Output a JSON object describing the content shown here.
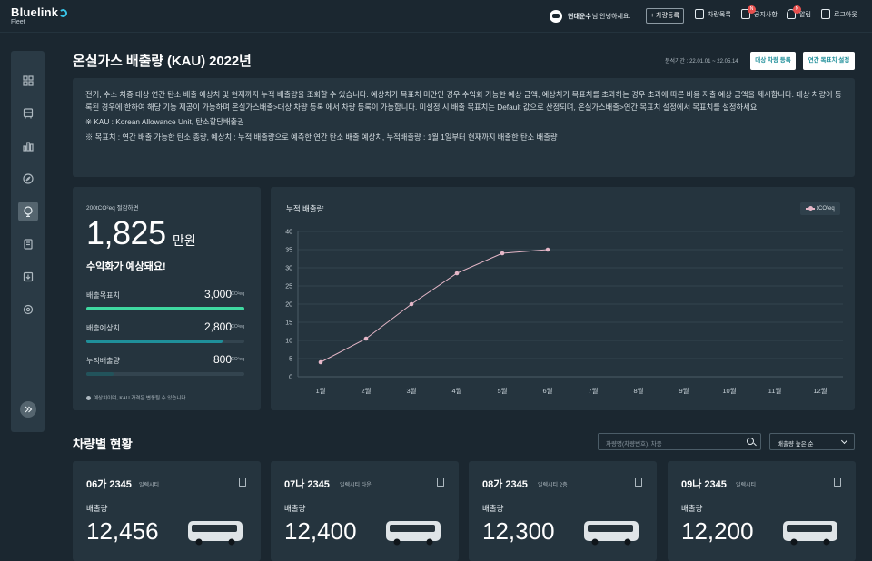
{
  "header": {
    "logo": "Bluelink",
    "logo_sub": "Fleet",
    "user_name": "현대운수",
    "user_greeting": "님 안녕하세요.",
    "register_btn": "+ 차량등록",
    "nav": [
      {
        "label": "차량목록",
        "icon": "vehicle-list-icon"
      },
      {
        "label": "공지사항",
        "icon": "notice-icon",
        "badge": "N"
      },
      {
        "label": "알림",
        "icon": "bell-icon",
        "badge": "N"
      },
      {
        "label": "로그아웃",
        "icon": "logout-icon"
      }
    ]
  },
  "sidebar": {
    "items": [
      "dashboard-icon",
      "bus-icon",
      "chart-icon",
      "compass-icon",
      "leaf-icon",
      "document-icon",
      "download-icon",
      "settings-icon"
    ],
    "active_index": 4
  },
  "page": {
    "title": "온실가스 배출량 (KAU) 2022년",
    "period": "분석기간 : 22.01.01 ~ 22.05.14",
    "btn_target_vehicle": "대상 차량 등록",
    "btn_annual_goal": "연간 목표치 설정"
  },
  "info": {
    "paragraph": "전기, 수소 차종 대상 연간 탄소 배출 예상치 및 현재까지 누적 배출량을 조회할 수 있습니다. 예상치가 목표치 미만인 경우 수익화 가능한 예상 금액, 예상치가 목표치를 초과하는 경우 초과에 따른 비용 지출 예상 금액을 제시합니다. 대상 차량이 등록된 경우에 한하여 해당 기능 제공이 가능하며 온실가스배출>대상 차량 등록 에서 차량 등록이 가능합니다. 미설정 시 배출 목표치는 Default 값으로 산정되며, 온실가스배출>연간 목표치 설정에서 목표치를 설정하세요.",
    "note1": "※ KAU : Korean Allowance Unit, 탄소할당배출권",
    "note2": "※ 목표치 : 연간 배출 가능한 탄소 총량, 예상치 : 누적 배출량으로 예측한 연간 탄소 배출 예상치, 누적배출량 : 1월 1일부터 현재까지 배출한 탄소 배출량"
  },
  "summary": {
    "subtitle": "200tCO²eq 절감하면",
    "amount": "1,825",
    "amount_unit": "만원",
    "message": "수익화가 예상돼요!",
    "metrics": [
      {
        "label": "배출목표치",
        "value": "3,000",
        "unit": "tCO²eq",
        "ratio": 1.0,
        "color": "#3fd8a0"
      },
      {
        "label": "배출예상치",
        "value": "2,800",
        "unit": "tCO²eq",
        "ratio": 0.86,
        "color": "#1f8f9a"
      },
      {
        "label": "누적배출량",
        "value": "800",
        "unit": "tCO²eq",
        "ratio": 0.17,
        "color": "#22535b"
      }
    ],
    "note": "예상치이며, KAU 가격은 변동될 수 있습니다."
  },
  "chart_data": {
    "type": "line",
    "title": "누적 배출량",
    "legend": "tCO²eq",
    "categories": [
      "1월",
      "2월",
      "3월",
      "4월",
      "5월",
      "6월",
      "7월",
      "8월",
      "9월",
      "10월",
      "11월",
      "12월"
    ],
    "series": [
      {
        "name": "tCO²eq",
        "values": [
          4,
          10.5,
          20,
          28.5,
          34,
          35,
          null,
          null,
          null,
          null,
          null,
          null
        ]
      }
    ],
    "yticks": [
      0,
      5,
      10,
      15,
      20,
      25,
      30,
      35,
      40
    ],
    "ylim": [
      0,
      40
    ],
    "grid": true,
    "line_color": "#e5b7c8"
  },
  "vehicles": {
    "section_title": "차량별 현황",
    "search_placeholder": "차량명(차량번호), 차종",
    "sort_label": "배출량 높은 순",
    "emission_label": "배출량",
    "items": [
      {
        "plate": "06가 2345",
        "model": "일렉시티",
        "value": "12,456"
      },
      {
        "plate": "07나 2345",
        "model": "일렉시티 타운",
        "value": "12,400"
      },
      {
        "plate": "08가 2345",
        "model": "일렉시티 2층",
        "value": "12,300"
      },
      {
        "plate": "09나 2345",
        "model": "일렉시티",
        "value": "12,200"
      }
    ]
  }
}
